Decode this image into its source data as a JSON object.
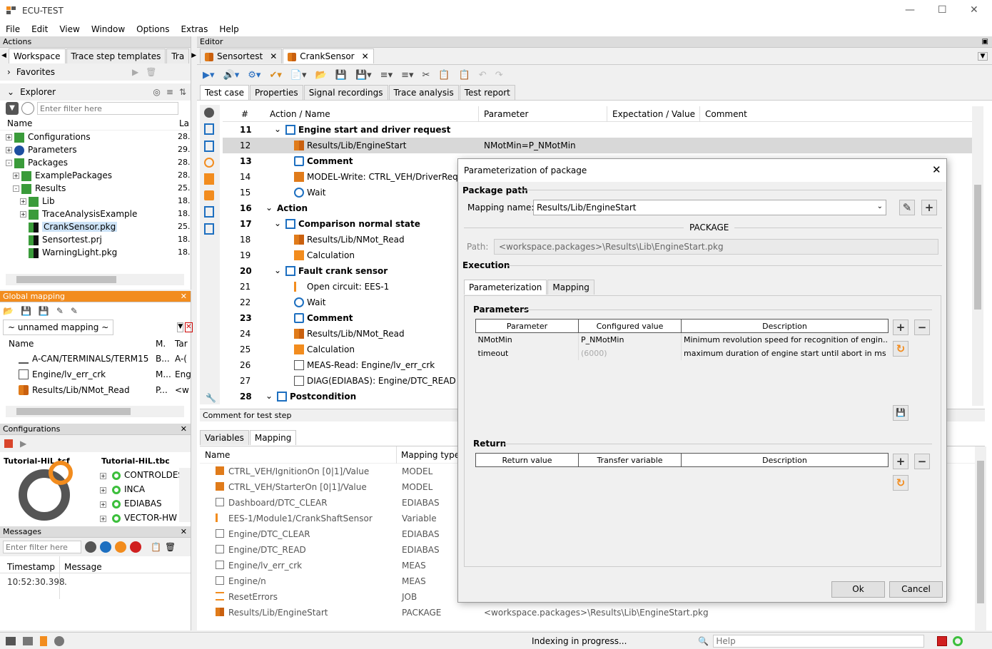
{
  "app": {
    "title": "ECU-TEST"
  },
  "menu": [
    "File",
    "Edit",
    "View",
    "Window",
    "Options",
    "Extras",
    "Help"
  ],
  "actions": {
    "title": "Actions",
    "tabs": [
      "Workspace",
      "Trace step templates",
      "Tra"
    ],
    "favorites": "Favorites",
    "explorer": "Explorer",
    "filter_placeholder": "Enter filter here",
    "col_name": "Name",
    "col_la": "La",
    "tree": [
      {
        "label": "Configurations",
        "date": "28."
      },
      {
        "label": "Parameters",
        "date": "29."
      },
      {
        "label": "Packages",
        "date": "28."
      },
      {
        "label": "ExamplePackages",
        "date": "28."
      },
      {
        "label": "Results",
        "date": "25."
      },
      {
        "label": "Lib",
        "date": "18."
      },
      {
        "label": "TraceAnalysisExample",
        "date": "18."
      },
      {
        "label": "CrankSensor.pkg",
        "date": "25."
      },
      {
        "label": "Sensortest.prj",
        "date": "18."
      },
      {
        "label": "WarningLight.pkg",
        "date": "18."
      }
    ]
  },
  "global_mapping": {
    "title": "Global mapping",
    "mapping_name": "~ unnamed mapping ~",
    "cols": [
      "Name",
      "M.",
      "Tar"
    ],
    "rows": [
      {
        "name": "A-CAN/TERMINALS/TERM15",
        "m": "B...",
        "t": "A-("
      },
      {
        "name": "Engine/lv_err_crk",
        "m": "M...",
        "t": "Eng"
      },
      {
        "name": "Results/Lib/NMot_Read",
        "m": "P...",
        "t": "<w"
      }
    ]
  },
  "configurations": {
    "title": "Configurations",
    "tcf": "Tutorial-HiL.tcf",
    "tbc": "Tutorial-HiL.tbc",
    "items": [
      "CONTROLDES",
      "INCA",
      "EDIABAS",
      "VECTOR-HW"
    ]
  },
  "messages": {
    "title": "Messages",
    "filter_placeholder": "Enter filter here",
    "cols": [
      "Timestamp",
      "Message"
    ],
    "rows": [
      {
        "ts": "10:52:30.398",
        "msg": "."
      }
    ]
  },
  "editor": {
    "title": "Editor",
    "doc_tabs": [
      "Sensortest",
      "CrankSensor"
    ],
    "sub_tabs": [
      "Test case",
      "Properties",
      "Signal recordings",
      "Trace analysis",
      "Test report"
    ],
    "cols": [
      "#",
      "Action / Name",
      "Parameter",
      "Expectation / Value",
      "Comment"
    ],
    "rows": [
      {
        "n": "11",
        "name": "Engine start and driver request",
        "param": "",
        "bold": true,
        "indent": 1
      },
      {
        "n": "12",
        "name": "Results/Lib/EngineStart",
        "param": "NMotMin=P_NMotMin",
        "bold": false,
        "indent": 2
      },
      {
        "n": "13",
        "name": "Comment",
        "param": "",
        "bold": true,
        "indent": 2
      },
      {
        "n": "14",
        "name": "MODEL-Write: CTRL_VEH/DriverReques",
        "param": "",
        "bold": false,
        "indent": 2
      },
      {
        "n": "15",
        "name": "Wait",
        "param": "",
        "bold": false,
        "indent": 2
      },
      {
        "n": "16",
        "name": "Action",
        "param": "",
        "bold": true,
        "indent": 0
      },
      {
        "n": "17",
        "name": "Comparison normal state",
        "param": "",
        "bold": true,
        "indent": 1
      },
      {
        "n": "18",
        "name": "Results/Lib/NMot_Read",
        "param": "",
        "bold": false,
        "indent": 2
      },
      {
        "n": "19",
        "name": "Calculation",
        "param": "",
        "bold": false,
        "indent": 2
      },
      {
        "n": "20",
        "name": "Fault crank sensor",
        "param": "",
        "bold": true,
        "indent": 1
      },
      {
        "n": "21",
        "name": "Open circuit: EES-1",
        "param": "",
        "bold": false,
        "indent": 2
      },
      {
        "n": "22",
        "name": "Wait",
        "param": "",
        "bold": false,
        "indent": 2
      },
      {
        "n": "23",
        "name": "Comment",
        "param": "",
        "bold": true,
        "indent": 2
      },
      {
        "n": "24",
        "name": "Results/Lib/NMot_Read",
        "param": "",
        "bold": false,
        "indent": 2
      },
      {
        "n": "25",
        "name": "Calculation",
        "param": "",
        "bold": false,
        "indent": 2
      },
      {
        "n": "26",
        "name": "MEAS-Read: Engine/lv_err_crk",
        "param": "",
        "bold": false,
        "indent": 2
      },
      {
        "n": "27",
        "name": "DIAG(EDIABAS): Engine/DTC_READ",
        "param": "",
        "bold": false,
        "indent": 2
      },
      {
        "n": "28",
        "name": "Postcondition",
        "param": "",
        "bold": true,
        "indent": 0
      }
    ],
    "comment_label": "Comment for test step",
    "bottom_tabs": [
      "Variables",
      "Mapping"
    ],
    "mapping_cols": [
      "Name",
      "Mapping type"
    ],
    "mapping_rows": [
      {
        "name": "CTRL_VEH/IgnitionOn [0|1]/Value",
        "type": "MODEL",
        "path": ""
      },
      {
        "name": "CTRL_VEH/StarterOn [0|1]/Value",
        "type": "MODEL",
        "path": ""
      },
      {
        "name": "Dashboard/DTC_CLEAR",
        "type": "EDIABAS",
        "path": ""
      },
      {
        "name": "EES-1/Module1/CrankShaftSensor",
        "type": "Variable",
        "path": ""
      },
      {
        "name": "Engine/DTC_CLEAR",
        "type": "EDIABAS",
        "path": ""
      },
      {
        "name": "Engine/DTC_READ",
        "type": "EDIABAS",
        "path": ""
      },
      {
        "name": "Engine/lv_err_crk",
        "type": "MEAS",
        "path": ""
      },
      {
        "name": "Engine/n",
        "type": "MEAS",
        "path": ""
      },
      {
        "name": "ResetErrors",
        "type": "JOB",
        "path": ""
      },
      {
        "name": "Results/Lib/EngineStart",
        "type": "PACKAGE",
        "path": "<workspace.packages>\\Results\\Lib\\EngineStart.pkg"
      }
    ]
  },
  "dialog": {
    "title": "Parameterization of package",
    "package_path": "Package path",
    "mapping_name_label": "Mapping name:",
    "mapping_name": "Results/Lib/EngineStart",
    "package_label": "PACKAGE",
    "path_label": "Path:",
    "path": "<workspace.packages>\\Results\\Lib\\EngineStart.pkg",
    "execution": "Execution",
    "tabs": [
      "Parameterization",
      "Mapping"
    ],
    "parameters": "Parameters",
    "param_cols": [
      "Parameter",
      "Configured value",
      "Description"
    ],
    "params": [
      {
        "p": "NMotMin",
        "v": "P_NMotMin",
        "d": "Minimum revolution speed for recognition of engin..."
      },
      {
        "p": "timeout",
        "v": "(6000)",
        "d": "maximum duration of engine start until abort in ms"
      }
    ],
    "return": "Return",
    "return_cols": [
      "Return value",
      "Transfer variable",
      "Description"
    ],
    "ok": "Ok",
    "cancel": "Cancel"
  },
  "status": {
    "indexing": "Indexing in progress...",
    "help_placeholder": "Help"
  }
}
